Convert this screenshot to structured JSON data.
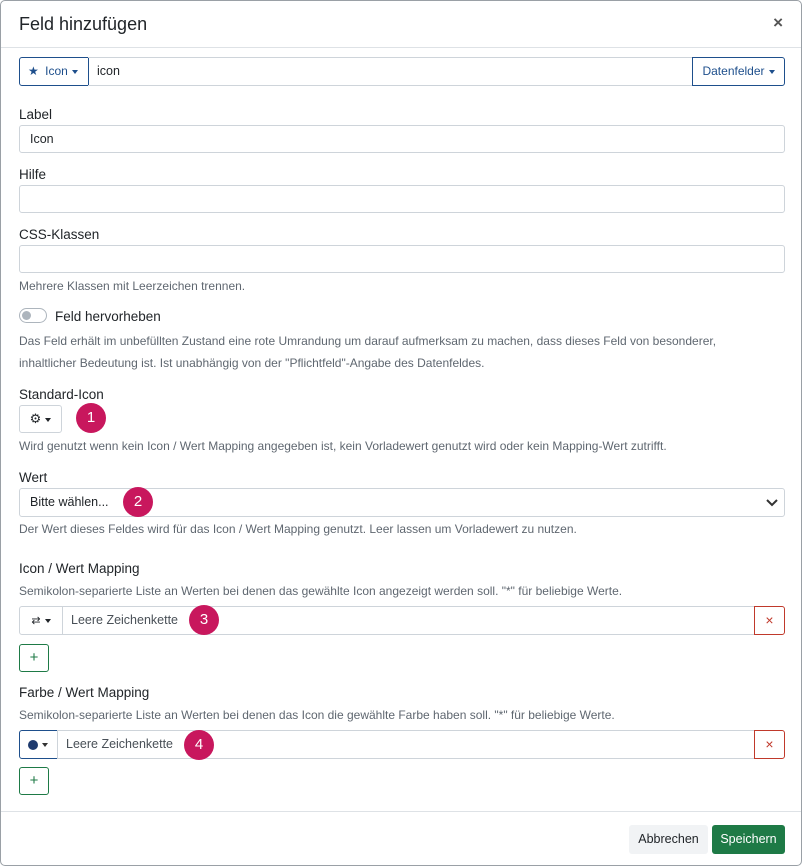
{
  "dialog": {
    "title": "Feld hinzufügen",
    "close": "×"
  },
  "top": {
    "type_label": "Icon",
    "field_value": "icon",
    "datafields_label": "Datenfelder"
  },
  "label_field": {
    "label": "Label",
    "value": "Icon"
  },
  "hilfe_field": {
    "label": "Hilfe",
    "value": ""
  },
  "css_field": {
    "label": "CSS-Klassen",
    "value": "",
    "help": "Mehrere Klassen mit Leerzeichen trennen."
  },
  "highlight": {
    "label": "Feld hervorheben",
    "help_line1": "Das Feld erhält im unbefüllten Zustand eine rote Umrandung um darauf aufmerksam zu machen, dass dieses Feld von besonderer,",
    "help_line2": "inhaltlicher Bedeutung ist. Ist unabhängig von der \"Pflichtfeld\"-Angabe des Datenfeldes."
  },
  "standard_icon": {
    "label": "Standard-Icon",
    "help": "Wird genutzt wenn kein Icon / Wert Mapping angegeben ist, kein Vorladewert genutzt wird oder kein Mapping-Wert zutrifft."
  },
  "wert": {
    "label": "Wert",
    "selected": "Bitte wählen...",
    "help": "Der Wert dieses Feldes wird für das Icon / Wert Mapping genutzt. Leer lassen um Vorladewert zu nutzen."
  },
  "icon_mapping": {
    "label": "Icon / Wert Mapping",
    "help": "Semikolon-separierte Liste an Werten bei denen das gewählte Icon angezeigt werden soll. \"*\" für beliebige Werte.",
    "placeholder": "Leere Zeichenkette",
    "remove": "×",
    "add": "+"
  },
  "color_mapping": {
    "label": "Farbe / Wert Mapping",
    "help": "Semikolon-separierte Liste an Werten bei denen das Icon die gewählte Farbe haben soll. \"*\" für beliebige Werte.",
    "placeholder": "Leere Zeichenkette",
    "remove": "×",
    "add": "+",
    "swatch_color": "#1e3a6e"
  },
  "annotations": [
    "1",
    "2",
    "3",
    "4"
  ],
  "footer": {
    "cancel": "Abbrechen",
    "save": "Speichern"
  },
  "colors": {
    "primary": "#1e4f8c",
    "success": "#1e7a46",
    "danger": "#c0392b",
    "annotation": "#c8175d"
  }
}
